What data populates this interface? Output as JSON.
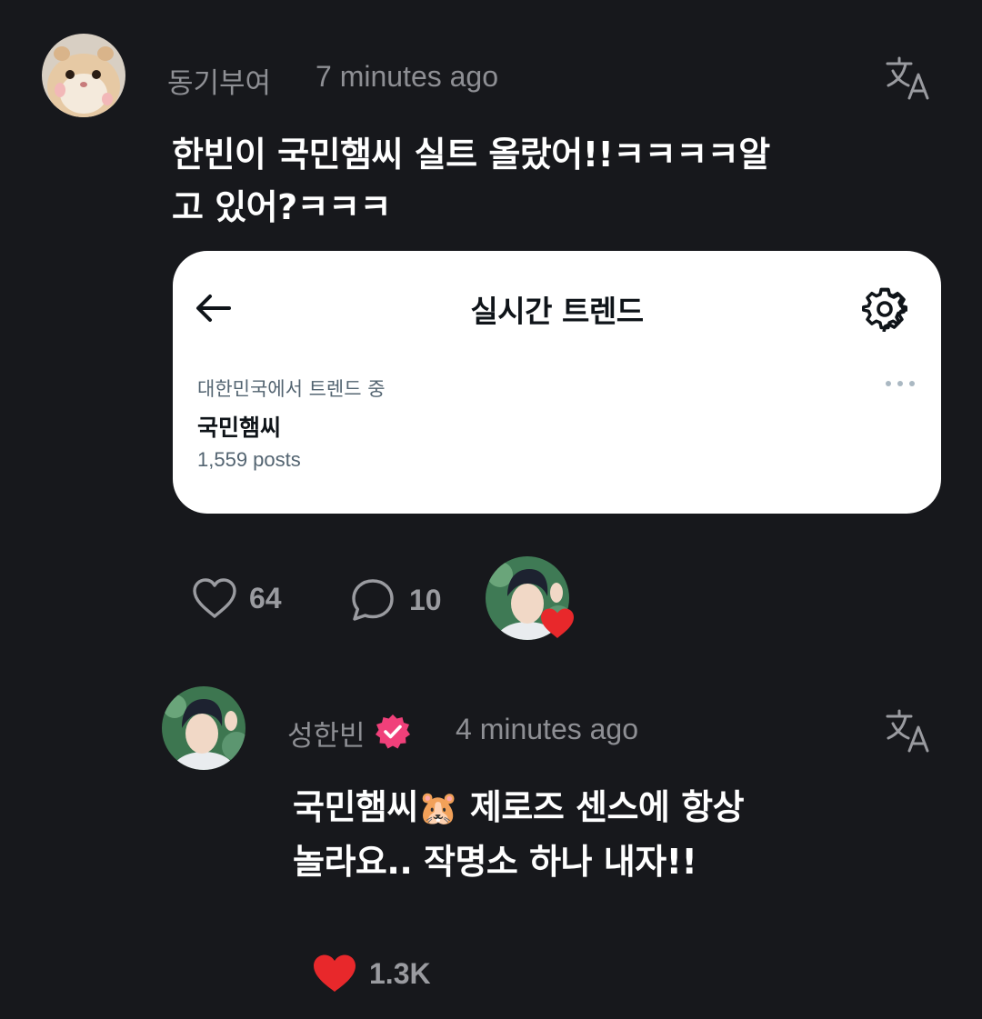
{
  "comment1": {
    "username": "동기부여",
    "time": "7 minutes ago",
    "text_line1": "한빈이 국민햄씨 실트 올랐어!!ㅋㅋㅋㅋ알",
    "text_line2": "고 있어?ㅋㅋㅋ",
    "avatar": "hamster-avatar",
    "translate_icon": "translate-icon",
    "likes": "64",
    "replies": "10",
    "liked_by_avatar": "liked-by-author-avatar"
  },
  "embed": {
    "title": "실시간 트렌드",
    "subtitle": "대한민국에서 트렌드 중",
    "trend": "국민햄씨",
    "count": "1,559 posts",
    "back_icon": "back-arrow-icon",
    "settings_icon": "gear-icon",
    "more_icon": "more-icon"
  },
  "comment2": {
    "username": "성한빈",
    "verified_icon": "verified-badge-icon",
    "time": "4 minutes ago",
    "text_line1_a": "국민햄씨",
    "emoji": "🐹",
    "text_line1_b": " 제로즈 센스에 항상",
    "text_line2": "놀라요.. 작명소 하나 내자!!",
    "likes": "1.3K",
    "translate_icon": "translate-icon"
  },
  "colors": {
    "background": "#17181c",
    "meta": "#8e8f94",
    "heart": "#e8282b",
    "verified": "#f0407a"
  }
}
